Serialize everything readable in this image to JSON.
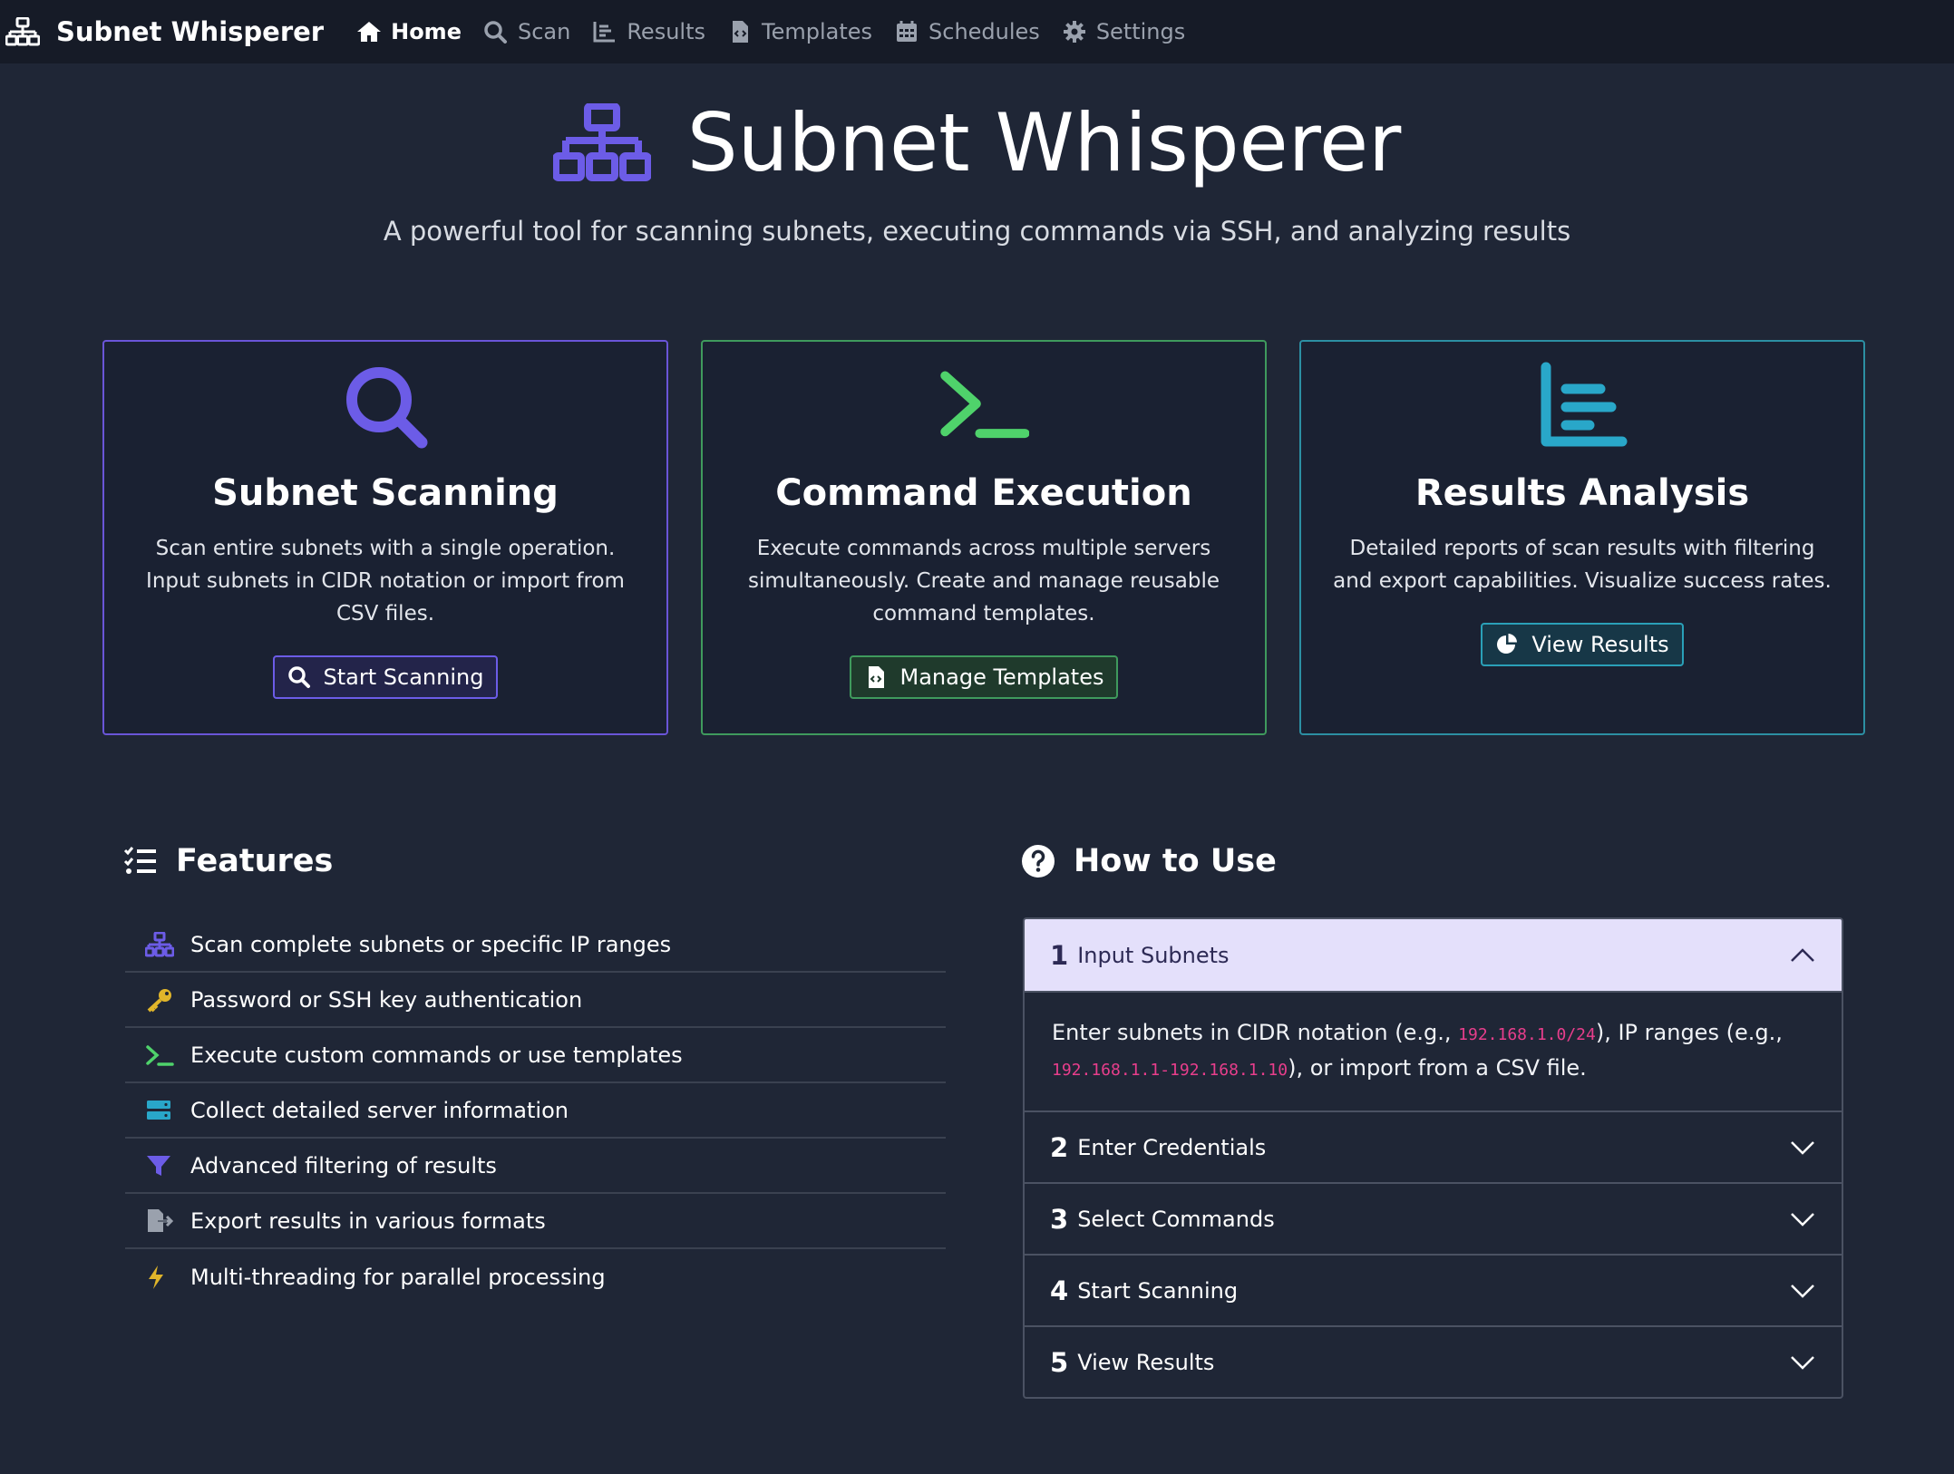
{
  "navbar": {
    "brand": "Subnet Whisperer",
    "items": [
      {
        "label": "Home",
        "icon": "home-icon",
        "active": true
      },
      {
        "label": "Scan",
        "icon": "search-icon",
        "active": false
      },
      {
        "label": "Results",
        "icon": "chart-bar-icon",
        "active": false
      },
      {
        "label": "Templates",
        "icon": "file-code-icon",
        "active": false
      },
      {
        "label": "Schedules",
        "icon": "calendar-icon",
        "active": false
      },
      {
        "label": "Settings",
        "icon": "gear-icon",
        "active": false
      }
    ]
  },
  "hero": {
    "title": "Subnet Whisperer",
    "subtitle": "A powerful tool for scanning subnets, executing commands via SSH, and analyzing results"
  },
  "cards": [
    {
      "title": "Subnet Scanning",
      "text": "Scan entire subnets with a single operation. Input subnets in CIDR notation or import from CSV files.",
      "button": "Start Scanning",
      "color": "#6c5ce7"
    },
    {
      "title": "Command Execution",
      "text": "Execute commands across multiple servers simultaneously. Create and manage reusable command templates.",
      "button": "Manage Templates",
      "color": "#3fbf5f"
    },
    {
      "title": "Results Analysis",
      "text": "Detailed reports of scan results with filtering and export capabilities. Visualize success rates.",
      "button": "View Results",
      "color": "#29a7c9"
    }
  ],
  "features": {
    "title": "Features",
    "items": [
      {
        "text": "Scan complete subnets or specific IP ranges",
        "icon": "network-icon"
      },
      {
        "text": "Password or SSH key authentication",
        "icon": "key-icon"
      },
      {
        "text": "Execute custom commands or use templates",
        "icon": "terminal-icon"
      },
      {
        "text": "Collect detailed server information",
        "icon": "server-icon"
      },
      {
        "text": "Advanced filtering of results",
        "icon": "filter-icon"
      },
      {
        "text": "Export results in various formats",
        "icon": "file-export-icon"
      },
      {
        "text": "Multi-threading for parallel processing",
        "icon": "bolt-icon"
      }
    ]
  },
  "howto": {
    "title": "How to Use",
    "steps": [
      {
        "num": "1",
        "label": "Input Subnets",
        "open": true
      },
      {
        "num": "2",
        "label": "Enter Credentials",
        "open": false
      },
      {
        "num": "3",
        "label": "Select Commands",
        "open": false
      },
      {
        "num": "4",
        "label": "Start Scanning",
        "open": false
      },
      {
        "num": "5",
        "label": "View Results",
        "open": false
      }
    ],
    "step1_body": {
      "pre": "Enter subnets in CIDR notation (e.g., ",
      "code1": "192.168.1.0/24",
      "mid": "), IP ranges (e.g., ",
      "code2": "192.168.1.1-192.168.1.10",
      "post": "), or import from a CSV file."
    }
  },
  "colors": {
    "purple": "#6c5ce7",
    "green": "#3fbf5f",
    "teal": "#29a7c9",
    "background": "#1f2636",
    "navbar": "#161b27"
  }
}
